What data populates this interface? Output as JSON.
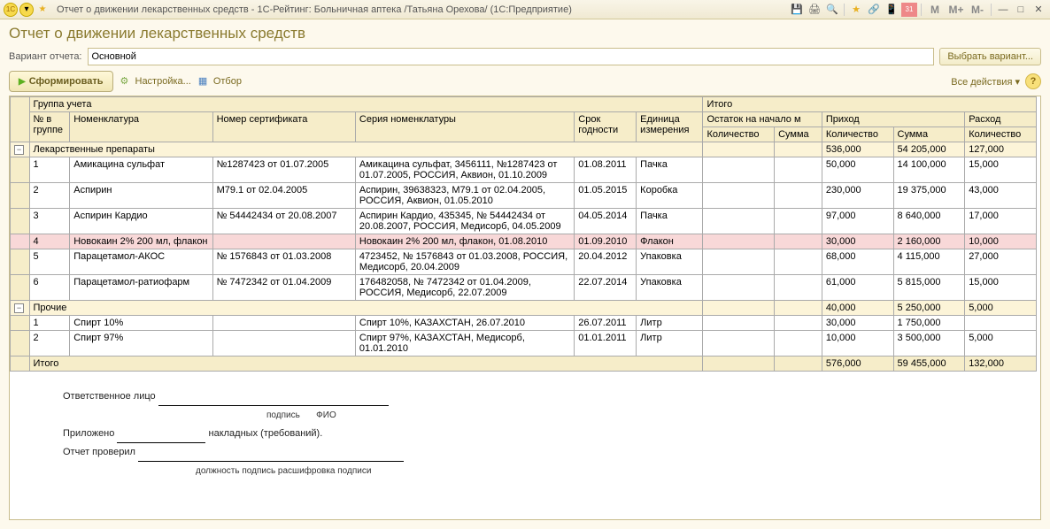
{
  "titlebar": {
    "title": "Отчет о движении лекарственных средств - 1С-Рейтинг: Больничная аптека /Татьяна Орехова/  (1С:Предприятие)"
  },
  "page": {
    "title": "Отчет о движении лекарственных средств",
    "variant_label": "Вариант отчета:",
    "variant_value": "Основной",
    "choose_variant": "Выбрать вариант...",
    "form_btn": "Сформировать",
    "settings_btn": "Настройка...",
    "filter_btn": "Отбор",
    "all_actions": "Все действия"
  },
  "columns": {
    "group": "Группа учета",
    "itogo": "Итого",
    "num": "№ в группе",
    "nomen": "Номенклатура",
    "cert": "Номер сертификата",
    "series": "Серия номенклатуры",
    "expiry": "Срок годности",
    "unit": "Единица измерения",
    "start": "Остаток на начало м",
    "prihod": "Приход",
    "rashod": "Расход",
    "qty": "Количество",
    "sum": "Сумма"
  },
  "groups": [
    {
      "name": "Лекарственные препараты",
      "totals": {
        "prihod_qty": "536,000",
        "prihod_sum": "54 205,000",
        "rashod_qty": "127,000"
      },
      "rows": [
        {
          "n": "1",
          "nomen": "Амикацина сульфат",
          "cert": "№1287423 от 01.07.2005",
          "series": "Амикацина сульфат, 3456111, №1287423 от 01.07.2005, РОССИЯ, Аквион, 01.10.2009",
          "expiry": "01.08.2011",
          "unit": "Пачка",
          "pq": "50,000",
          "ps": "14 100,000",
          "rq": "15,000",
          "hl": false
        },
        {
          "n": "2",
          "nomen": "Аспирин",
          "cert": "М79.1 от 02.04.2005",
          "series": "Аспирин, 39638323, М79.1 от 02.04.2005, РОССИЯ, Аквион, 01.05.2010",
          "expiry": "01.05.2015",
          "unit": "Коробка",
          "pq": "230,000",
          "ps": "19 375,000",
          "rq": "43,000",
          "hl": false
        },
        {
          "n": "3",
          "nomen": "Аспирин Кардио",
          "cert": "№ 54442434 от 20.08.2007",
          "series": "Аспирин Кардио, 435345, № 54442434 от 20.08.2007, РОССИЯ, Медисорб, 04.05.2009",
          "expiry": "04.05.2014",
          "unit": "Пачка",
          "pq": "97,000",
          "ps": "8 640,000",
          "rq": "17,000",
          "hl": false
        },
        {
          "n": "4",
          "nomen": "Новокаин 2% 200 мл, флакон",
          "cert": "",
          "series": "Новокаин 2% 200 мл, флакон, 01.08.2010",
          "expiry": "01.09.2010",
          "unit": "Флакон",
          "pq": "30,000",
          "ps": "2 160,000",
          "rq": "10,000",
          "hl": true
        },
        {
          "n": "5",
          "nomen": "Парацетамол-АКОС",
          "cert": "№ 1576843 от 01.03.2008",
          "series": "4723452, № 1576843 от 01.03.2008, РОССИЯ, Медисорб, 20.04.2009",
          "expiry": "20.04.2012",
          "unit": "Упаковка",
          "pq": "68,000",
          "ps": "4 115,000",
          "rq": "27,000",
          "hl": false
        },
        {
          "n": "6",
          "nomen": "Парацетамол-ратиофарм",
          "cert": "№ 7472342 от 01.04.2009",
          "series": "176482058, № 7472342 от 01.04.2009, РОССИЯ, Медисорб, 22.07.2009",
          "expiry": "22.07.2014",
          "unit": "Упаковка",
          "pq": "61,000",
          "ps": "5 815,000",
          "rq": "15,000",
          "hl": false
        }
      ]
    },
    {
      "name": "Прочие",
      "totals": {
        "prihod_qty": "40,000",
        "prihod_sum": "5 250,000",
        "rashod_qty": "5,000"
      },
      "rows": [
        {
          "n": "1",
          "nomen": "Спирт 10%",
          "cert": "",
          "series": "Спирт 10%, КАЗАХСТАН, 26.07.2010",
          "expiry": "26.07.2011",
          "unit": "Литр",
          "pq": "30,000",
          "ps": "1 750,000",
          "rq": "",
          "hl": false
        },
        {
          "n": "2",
          "nomen": "Спирт 97%",
          "cert": "",
          "series": "Спирт 97%, КАЗАХСТАН, Медисорб, 01.01.2010",
          "expiry": "01.01.2011",
          "unit": "Литр",
          "pq": "10,000",
          "ps": "3 500,000",
          "rq": "5,000",
          "hl": false
        }
      ]
    }
  ],
  "grand_total": {
    "label": "Итого",
    "pq": "576,000",
    "ps": "59 455,000",
    "rq": "132,000"
  },
  "signatures": {
    "responsible": "Ответственное лицо",
    "podpis": "подпись",
    "fio": "ФИО",
    "attached": "Приложено",
    "naklad": "накладных (требований).",
    "checked": "Отчет проверил",
    "footer": "должность подпись расшифровка подписи"
  }
}
